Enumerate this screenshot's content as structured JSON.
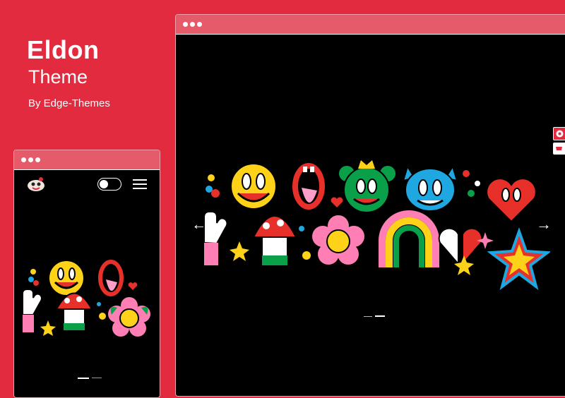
{
  "brand": {
    "title": "Eldon",
    "subtitle": "Theme",
    "byline": "By Edge-Themes"
  },
  "colors": {
    "background": "#e32b3f",
    "browser_bar": "#e55b6a",
    "screen": "#000000"
  },
  "icons": {
    "mobile_header": [
      "logo-icon",
      "dark-mode-toggle-icon",
      "hamburger-menu-icon"
    ],
    "desktop_nav": [
      "arrow-left-icon",
      "arrow-right-icon"
    ],
    "side_buttons": [
      "life-ring-icon",
      "cart-icon"
    ]
  },
  "slider": {
    "arrow_prev": "←",
    "arrow_next": "→"
  },
  "illustrations": [
    "smiley-face",
    "open-mouth",
    "bear-face",
    "cat-face",
    "heart-face",
    "hand",
    "mushroom",
    "flower-face",
    "rainbow",
    "broken-heart",
    "star"
  ]
}
